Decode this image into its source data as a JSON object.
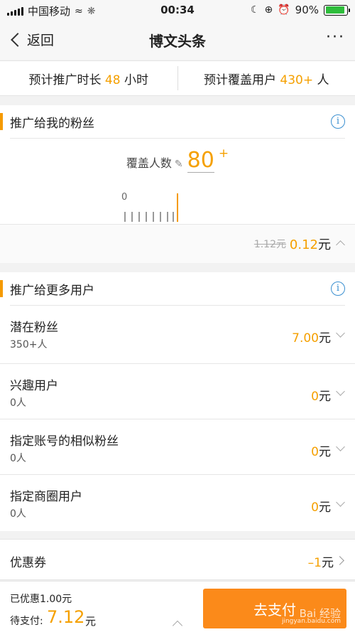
{
  "status_bar": {
    "carrier": "中国移动",
    "time": "00:34",
    "battery": "90%",
    "battery_level": 0.9
  },
  "nav": {
    "back_label": "返回",
    "title": "博文头条",
    "more_label": "···"
  },
  "summary": {
    "duration_prefix": "预计推广时长",
    "duration_value": "48",
    "duration_unit": "小时",
    "coverage_prefix": "预计覆盖用户",
    "coverage_value": "430+",
    "coverage_unit": "人"
  },
  "fans_section": {
    "title": "推广给我的粉丝",
    "coverage_label": "覆盖人数",
    "coverage_value": "80",
    "coverage_plus": "+",
    "slider_min": "0",
    "old_price": "1.12元",
    "new_price": "0.12",
    "price_unit": "元"
  },
  "more_section": {
    "title": "推广给更多用户",
    "options": [
      {
        "title": "潜在粉丝",
        "sub": "350+人",
        "price": "7.00",
        "unit": "元"
      },
      {
        "title": "兴趣用户",
        "sub": "0人",
        "price": "0",
        "unit": "元"
      },
      {
        "title": "指定账号的相似粉丝",
        "sub": "0人",
        "price": "0",
        "unit": "元"
      },
      {
        "title": "指定商圈用户",
        "sub": "0人",
        "price": "0",
        "unit": "元"
      }
    ]
  },
  "coupon": {
    "label": "优惠券",
    "value": "–1",
    "unit": "元"
  },
  "footer": {
    "discount": "已优惠1.00元",
    "to_pay_label": "待支付:",
    "to_pay_value": "7.12",
    "to_pay_unit": "元",
    "pay_button": "去支付"
  },
  "watermark": {
    "line1": "Bai 经验",
    "line2": "jingyan.baidu.com"
  },
  "colors": {
    "accent": "#f5a000",
    "pay_button": "#fb8a1a",
    "info": "#3a8fd0",
    "battery": "#2ebd3b"
  }
}
